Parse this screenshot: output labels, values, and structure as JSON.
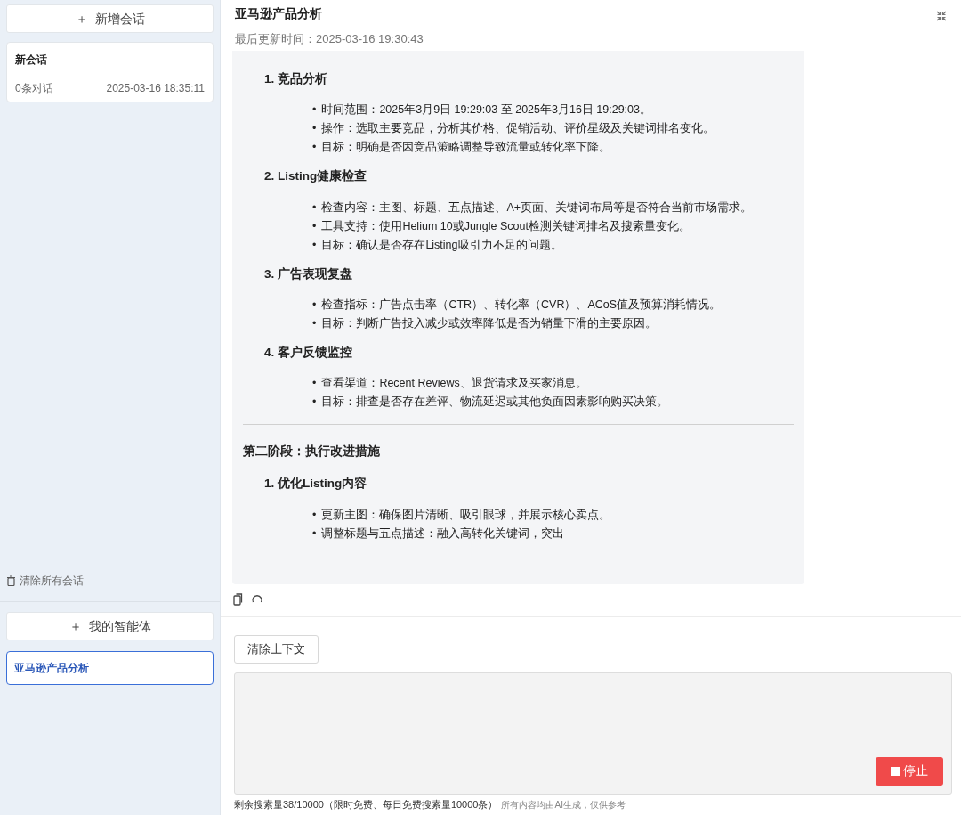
{
  "sidebar": {
    "new_chat_button": {
      "icon": "＋",
      "label": "新增会话"
    },
    "conversations": [
      {
        "title": "新会话",
        "count": "0条对话",
        "time": "2025-03-16 18:35:11",
        "selected": false
      }
    ],
    "clear_all": "清除所有会话",
    "agents_button": {
      "icon": "＋",
      "label": "我的智能体"
    },
    "agents": [
      {
        "name": "亚马逊产品分析",
        "selected": true
      }
    ]
  },
  "header": {
    "title": "亚马逊产品分析",
    "updated": "最后更新时间：2025-03-16 19:30:43"
  },
  "message": {
    "blocks": [
      {
        "kind": "heading",
        "number": "1.",
        "text": "竞品分析",
        "marker": "•",
        "bullets": [
          "时间范围：2025年3月9日 19:29:03 至 2025年3月16日 19:29:03。",
          "操作：选取主要竞品，分析其价格、促销活动、评价星级及关键词排名变化。",
          "目标：明确是否因竞品策略调整导致流量或转化率下降。"
        ]
      },
      {
        "kind": "heading",
        "number": "2.",
        "text": "Listing健康检查",
        "marker": "•",
        "bullets": [
          "检查内容：主图、标题、五点描述、A+页面、关键词布局等是否符合当前市场需求。",
          "工具支持：使用Helium 10或Jungle Scout检测关键词排名及搜索量变化。",
          "目标：确认是否存在Listing吸引力不足的问题。"
        ]
      },
      {
        "kind": "heading",
        "number": "3.",
        "text": "广告表现复盘",
        "marker": "•",
        "bullets": [
          "检查指标：广告点击率（CTR）、转化率（CVR）、ACoS值及预算消耗情况。",
          "目标：判断广告投入减少或效率降低是否为销量下滑的主要原因。"
        ]
      },
      {
        "kind": "heading",
        "number": "4.",
        "text": "客户反馈监控",
        "marker": "•",
        "bullets": [
          "查看渠道：Recent Reviews、退货请求及买家消息。",
          "目标：排查是否存在差评、物流延迟或其他负面因素影响购买决策。"
        ]
      },
      {
        "kind": "rule"
      },
      {
        "kind": "stage",
        "text": "第二阶段：执行改进措施"
      },
      {
        "kind": "heading",
        "number": "1.",
        "text": "优化Listing内容",
        "marker": "•",
        "bullets": [
          "更新主图：确保图片清晰、吸引眼球，并展示核心卖点。",
          "调整标题与五点描述：融入高转化关键词，突出"
        ]
      }
    ]
  },
  "composer": {
    "clear_context": "清除上下文",
    "stop_button": "停止",
    "quota": "剩余搜索量38/10000（限时免费、每日免费搜索量10000条）",
    "disclaimer": "所有内容均由AI生成，仅供参考"
  }
}
